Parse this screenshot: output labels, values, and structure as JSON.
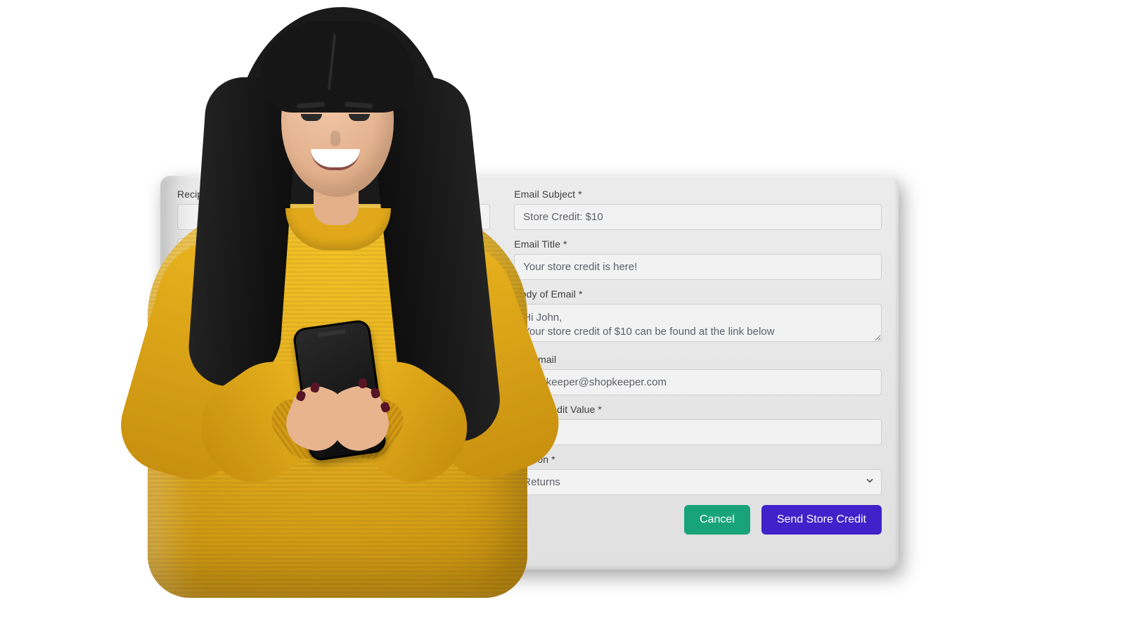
{
  "colors": {
    "panel_bg": "#e7e7e7",
    "input_bg": "#f2f2f2",
    "input_border": "#cfcfcf",
    "text": "#3d3d3d",
    "value_text": "#5b6069",
    "btn_cancel_bg": "#19a37a",
    "btn_primary_bg": "#3f22c9",
    "btn_text": "#ffffff"
  },
  "left": {
    "recipient_name": {
      "label": "Recipient Name *",
      "value": ""
    }
  },
  "right": {
    "email_subject": {
      "label": "Email Subject *",
      "value": "Store Credit: $10"
    },
    "email_title": {
      "label": "Email Title *",
      "value": "Your store credit is here!"
    },
    "body": {
      "label": "Body of Email *",
      "value": "Hi John,\nYour store credit of $10 can be found at the link below"
    },
    "cc_email": {
      "label": "CC Email",
      "value": "shopkeeper@shopkeeper.com"
    },
    "credit_value": {
      "label": "Store Credit Value *",
      "value": "10"
    },
    "reason": {
      "label": "Reason *",
      "selected": "Returns"
    }
  },
  "actions": {
    "cancel": "Cancel",
    "send": "Send Store Credit"
  },
  "illustration": {
    "description": "Smiling woman with long dark hair wearing a mustard-yellow knit sweater, looking down at a black smartphone held in both hands"
  }
}
